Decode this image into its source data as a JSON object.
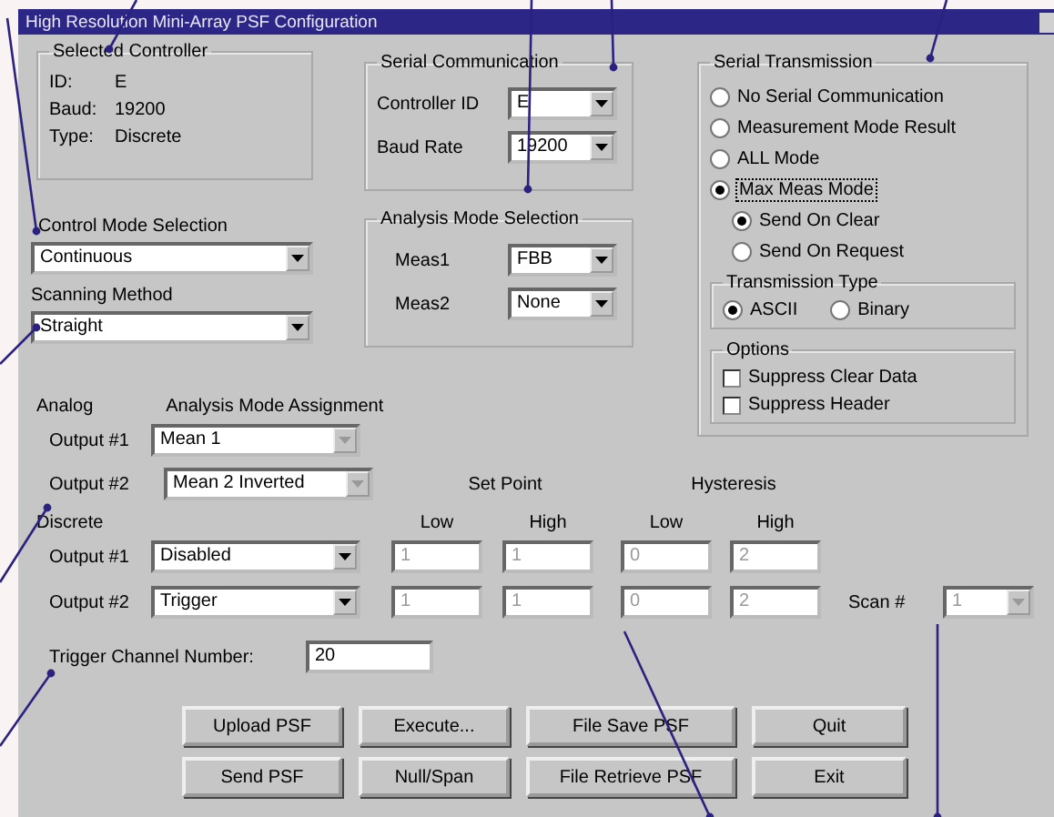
{
  "window": {
    "title": "High Resolution Mini-Array PSF Configuration"
  },
  "selected_controller": {
    "title": "Selected Controller",
    "fields": [
      {
        "label": "ID:",
        "value": "E"
      },
      {
        "label": "Baud:",
        "value": "19200"
      },
      {
        "label": "Type:",
        "value": "Discrete"
      }
    ]
  },
  "control_mode": {
    "label": "Control Mode Selection",
    "value": "Continuous"
  },
  "scanning_method": {
    "label": "Scanning Method",
    "value": "Straight"
  },
  "serial_communication": {
    "title": "Serial Communication",
    "fields": [
      {
        "label": "Controller ID",
        "value": "E"
      },
      {
        "label": "Baud Rate",
        "value": "19200"
      }
    ]
  },
  "analysis_mode_selection": {
    "title": "Analysis Mode Selection",
    "fields": [
      {
        "label": "Meas1",
        "value": "FBB"
      },
      {
        "label": "Meas2",
        "value": "None"
      }
    ]
  },
  "serial_transmission": {
    "title": "Serial Transmission",
    "modes": [
      {
        "label": "No Serial Communication",
        "selected": false,
        "focused": false
      },
      {
        "label": "Measurement Mode Result",
        "selected": false,
        "focused": false
      },
      {
        "label": "ALL Mode",
        "selected": false,
        "focused": false
      },
      {
        "label": "Max Meas Mode",
        "selected": true,
        "focused": true
      }
    ],
    "sub_modes": [
      {
        "label": "Send On Clear",
        "selected": true
      },
      {
        "label": "Send On Request",
        "selected": false
      }
    ],
    "transmission_type": {
      "title": "Transmission Type",
      "options": [
        {
          "label": "ASCII",
          "selected": true
        },
        {
          "label": "Binary",
          "selected": false
        }
      ]
    },
    "options": {
      "title": "Options",
      "items": [
        {
          "label": "Suppress Clear Data",
          "checked": false
        },
        {
          "label": "Suppress Header",
          "checked": false
        }
      ]
    }
  },
  "analog": {
    "label": "Analog",
    "heading": "Analysis Mode Assignment",
    "outputs": [
      {
        "label": "Output #1",
        "value": "Mean 1",
        "disabled": true
      },
      {
        "label": "Output #2",
        "value": "Mean 2 Inverted",
        "disabled": true
      }
    ]
  },
  "set_point": {
    "title": "Set Point",
    "columns": [
      "Low",
      "High"
    ]
  },
  "hysteresis": {
    "title": "Hysteresis",
    "columns": [
      "Low",
      "High"
    ]
  },
  "discrete": {
    "label": "Discrete",
    "outputs": [
      {
        "label": "Output #1",
        "value": "Disabled",
        "set_point": [
          "1",
          "1"
        ],
        "hysteresis": [
          "0",
          "2"
        ],
        "disabled": true
      },
      {
        "label": "Output #2",
        "value": "Trigger",
        "set_point": [
          "1",
          "1"
        ],
        "hysteresis": [
          "0",
          "2"
        ],
        "disabled": true
      }
    ]
  },
  "scan": {
    "label": "Scan #",
    "value": "1",
    "disabled": true
  },
  "trigger_channel": {
    "label": "Trigger Channel Number:",
    "value": "20"
  },
  "buttons": [
    [
      "Upload PSF",
      "Execute...",
      "File Save PSF",
      "Quit"
    ],
    [
      "Send PSF",
      "Null/Span",
      "File Retrieve PSF",
      "Exit"
    ]
  ]
}
